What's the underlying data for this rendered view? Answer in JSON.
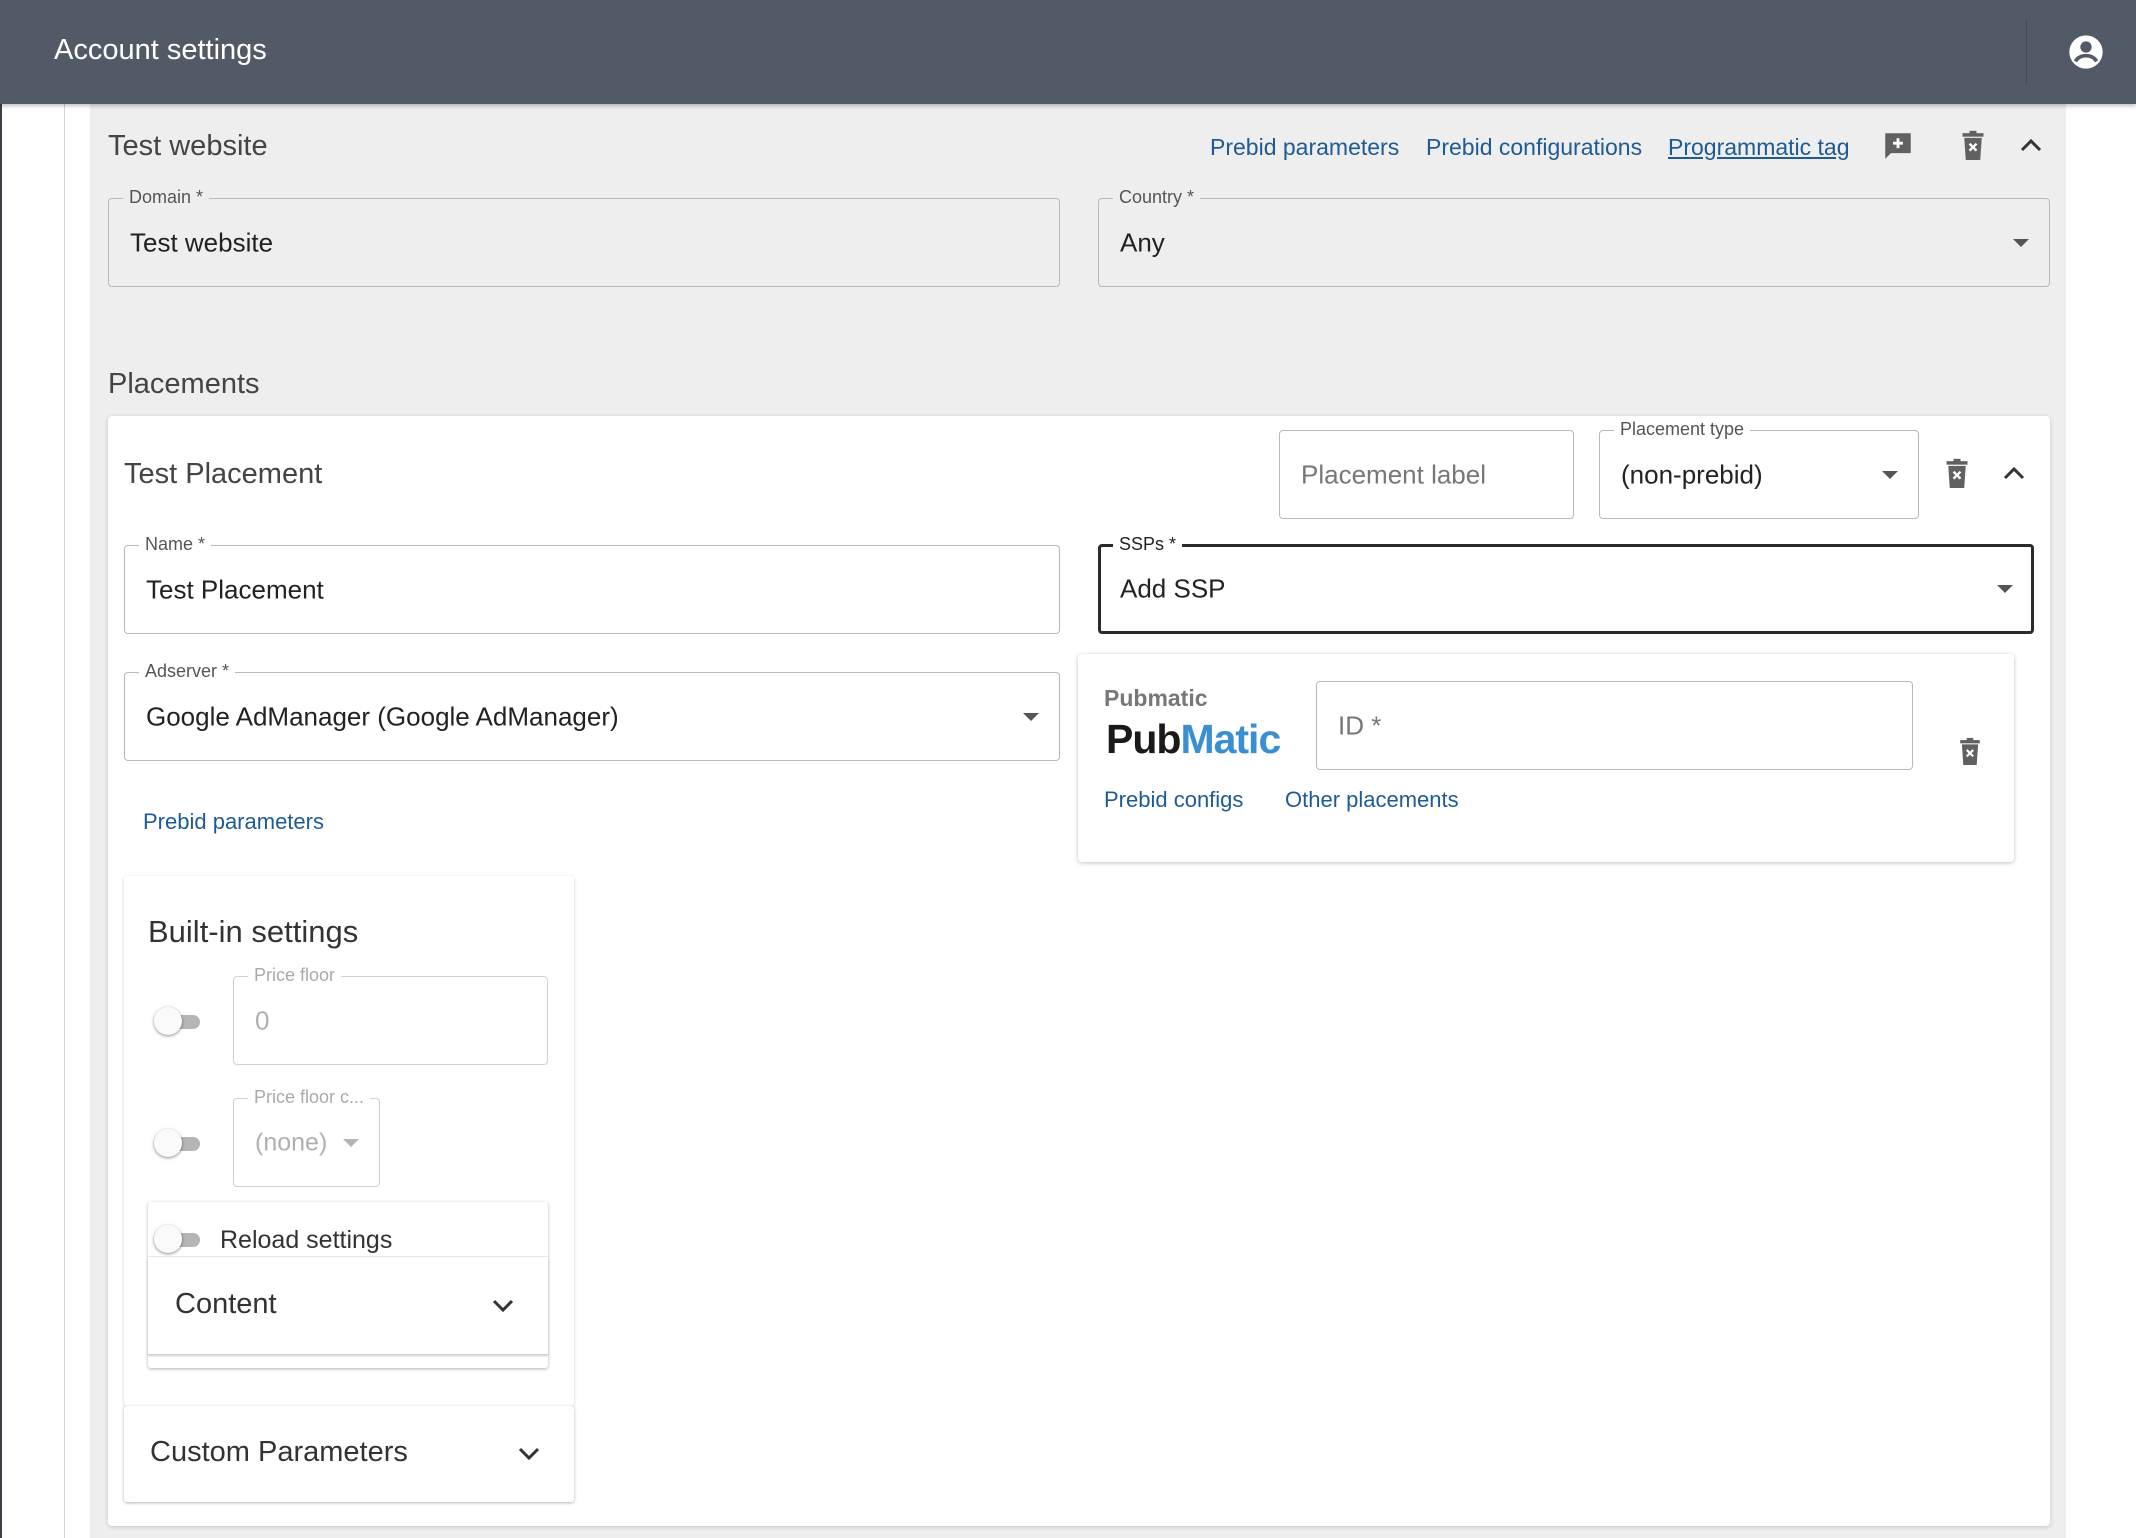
{
  "header": {
    "title": "Account settings",
    "account_icon": "account-circle-icon"
  },
  "website": {
    "title": "Test website",
    "links": {
      "prebid_parameters": "Prebid parameters",
      "prebid_configurations": "Prebid configurations",
      "programmatic_tag": "Programmatic tag"
    },
    "icons": [
      "add-comment-icon",
      "delete-icon",
      "chevron-up-icon"
    ],
    "domain": {
      "label": "Domain *",
      "value": "Test website"
    },
    "country": {
      "label": "Country *",
      "value": "Any"
    }
  },
  "placements": {
    "section_title": "Placements",
    "card": {
      "title": "Test Placement",
      "placement_label": {
        "placeholder": "Placement label"
      },
      "placement_type": {
        "label": "Placement type",
        "value": "(non-prebid)"
      },
      "name": {
        "label": "Name *",
        "value": "Test Placement"
      },
      "ssps": {
        "label": "SSPs *",
        "value": "Add SSP"
      },
      "adserver": {
        "label": "Adserver *",
        "value": "Google AdManager (Google AdManager)"
      },
      "prebid_parameters_link": "Prebid parameters",
      "ssp_item": {
        "name": "Pubmatic",
        "logo_pub": "Pub",
        "logo_matic": "Matic",
        "id_placeholder": "ID *",
        "prebid_configs_link": "Prebid configs",
        "other_placements_link": "Other placements"
      },
      "builtin": {
        "title": "Built-in settings",
        "price_floor": {
          "label": "Price floor",
          "value": "0",
          "enabled": false
        },
        "price_floor_currency": {
          "label": "Price floor c...",
          "value": "(none)",
          "enabled": false
        },
        "reload": {
          "label": "Reload settings",
          "enabled": false
        },
        "content_label": "Content"
      },
      "custom_parameters": "Custom Parameters"
    }
  },
  "colors": {
    "header_bg": "#525a68",
    "panel_bg": "#eeeeee",
    "link": "#1e5b94",
    "pubmatic_blue": "#3b8fd1"
  }
}
